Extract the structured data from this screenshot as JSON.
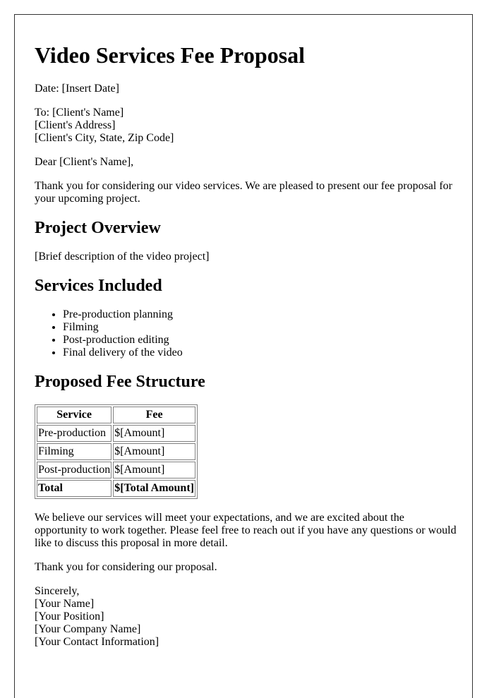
{
  "document": {
    "title": "Video Services Fee Proposal",
    "date_line": "Date: [Insert Date]",
    "recipient": {
      "to_line": "To: [Client's Name]",
      "address": "[Client's Address]",
      "city_state_zip": "[Client's City, State, Zip Code]"
    },
    "salutation": "Dear [Client's Name],",
    "intro": "Thank you for considering our video services. We are pleased to present our fee proposal for your upcoming project.",
    "sections": {
      "overview": {
        "heading": "Project Overview",
        "body": "[Brief description of the video project]"
      },
      "services": {
        "heading": "Services Included",
        "items": [
          "Pre-production planning",
          "Filming",
          "Post-production editing",
          "Final delivery of the video"
        ]
      },
      "fees": {
        "heading": "Proposed Fee Structure",
        "columns": [
          "Service",
          "Fee"
        ],
        "rows": [
          {
            "service": "Pre-production",
            "fee": "$[Amount]"
          },
          {
            "service": "Filming",
            "fee": "$[Amount]"
          },
          {
            "service": "Post-production",
            "fee": "$[Amount]"
          }
        ],
        "total": {
          "label": "Total",
          "fee": "$[Total Amount]"
        }
      }
    },
    "closing_paragraph": "We believe our services will meet your expectations, and we are excited about the opportunity to work together. Please feel free to reach out if you have any questions or would like to discuss this proposal in more detail.",
    "thanks": "Thank you for considering our proposal.",
    "signature": {
      "valediction": "Sincerely,",
      "name": "[Your Name]",
      "position": "[Your Position]",
      "company": "[Your Company Name]",
      "contact": "[Your Contact Information]"
    }
  }
}
